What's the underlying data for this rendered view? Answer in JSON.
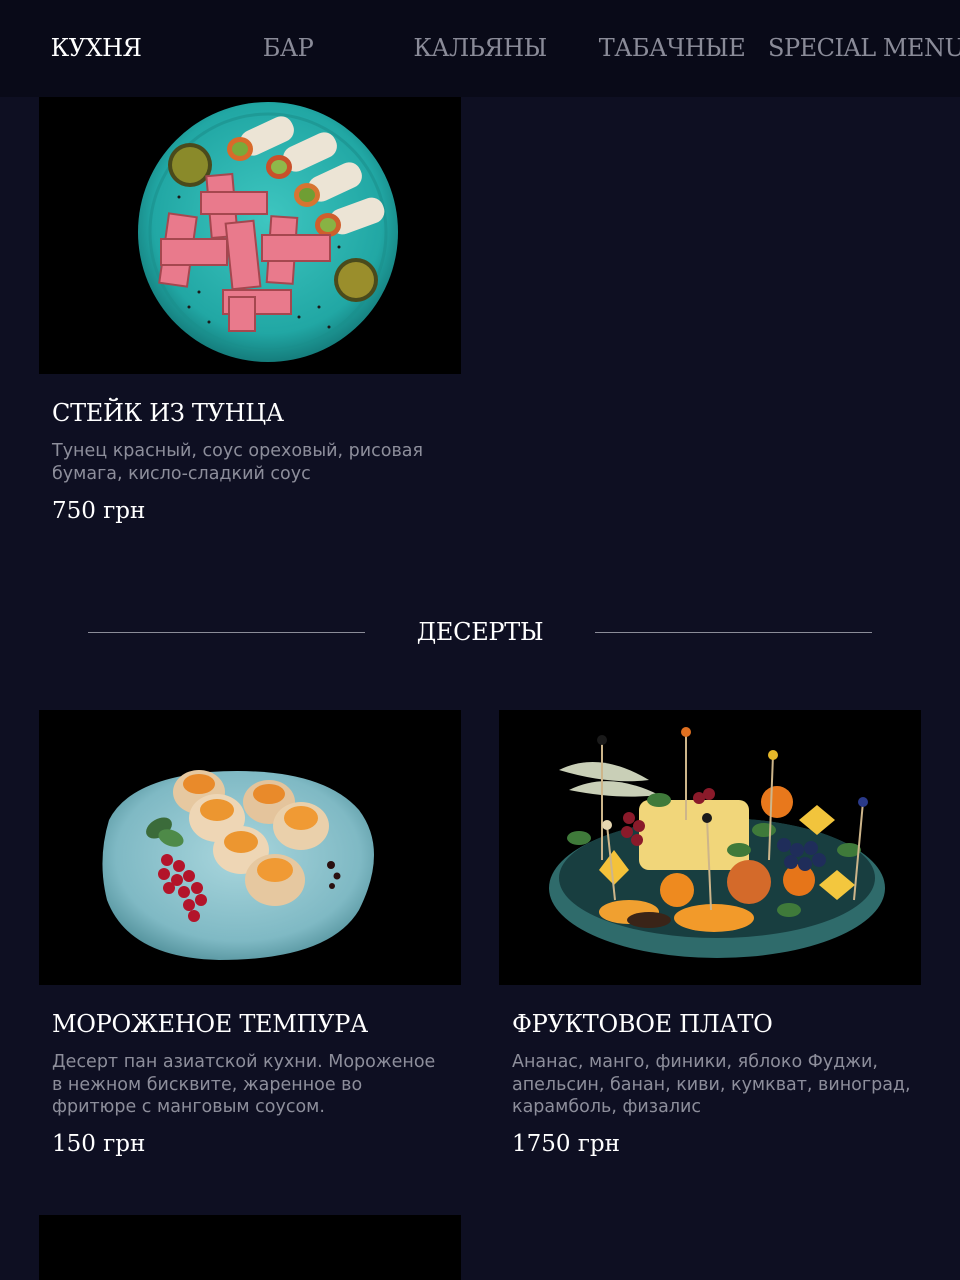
{
  "nav": {
    "items": [
      {
        "label": "КУХНЯ",
        "active": true
      },
      {
        "label": "БАР",
        "active": false
      },
      {
        "label": "КАЛЬЯНЫ",
        "active": false
      },
      {
        "label": "ТАБАЧНЫЕ",
        "active": false
      },
      {
        "label": "SPECIAL MENU",
        "active": false
      }
    ]
  },
  "menu": {
    "tuna": {
      "title": "СТЕЙК ИЗ ТУНЦА",
      "description": "Тунец красный, соус ореховый, рисовая бумага, кисло-сладкий соус",
      "price": "750 грн"
    },
    "desserts_section": {
      "title": "ДЕСЕРТЫ"
    },
    "desserts": [
      {
        "title": "МОРОЖЕНОЕ ТЕМПУРА",
        "description": "Десерт пан азиатской кухни. Мороженое в нежном бисквите, жаренное во фритюре с манговым соусом.",
        "price": "150 грн"
      },
      {
        "title": "ФРУКТОВОЕ ПЛАТО",
        "description": "Ананас, манго, финики, яблоко Фуджи, апельсин, банан, киви, кумкват, виноград, карамболь, физалис",
        "price": "1750 грн"
      }
    ]
  },
  "colors": {
    "background": "#0e0f22",
    "nav_background": "#090a18",
    "text_primary": "#ffffff",
    "text_muted": "#8d8e9b",
    "divider": "#8b8c98"
  }
}
